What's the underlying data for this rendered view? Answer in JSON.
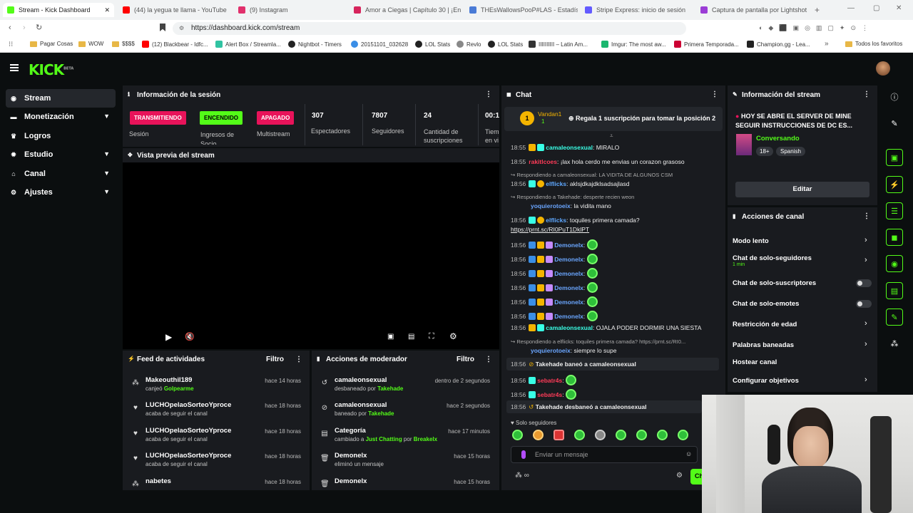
{
  "browser": {
    "tabs": [
      {
        "label": "Stream - Kick Dashboard",
        "color": "#53fc18"
      },
      {
        "label": "(44) la yegua te llama - YouTube",
        "color": "#ff0000"
      },
      {
        "label": "(9) Instagram",
        "color": "#e1306c"
      },
      {
        "label": "Amor a Ciegas | Capítulo 30 | ¡En bu",
        "color": "#d6245c"
      },
      {
        "label": "THEsWallowsPooP#LAS - Estadístic",
        "color": "#4a7bd6"
      },
      {
        "label": "Stripe Express: inicio de sesión",
        "color": "#635bff"
      },
      {
        "label": "Captura de pantalla por Lightshot",
        "color": "#9b3dd6"
      }
    ],
    "url": "https://dashboard.kick.com/stream",
    "bookmarks": [
      "Pagar Cosas",
      "WOW",
      "$$$$",
      "(12) Blackbear - Idfc...",
      "Alert Box / Streamla...",
      "Nightbot - Timers",
      "20151101_032628",
      "LOL Stats",
      "Revlo",
      "LOL Stats",
      "IIIIIIIIII – Latin Am...",
      "Imgur: The most aw...",
      "Primera Temporada...",
      "Champion.gg - Lea...",
      "Todos los favoritos"
    ]
  },
  "app": {
    "logo": "KICK",
    "logo_sup": "BETA"
  },
  "nav": [
    {
      "label": "Stream"
    },
    {
      "label": "Monetización"
    },
    {
      "label": "Logros"
    },
    {
      "label": "Estudio"
    },
    {
      "label": "Canal"
    },
    {
      "label": "Ajustes"
    }
  ],
  "session": {
    "title": "Información de la sesión",
    "badges": [
      {
        "text": "TRANSMITIENDO",
        "label": "Sesión",
        "bg": "#e8135a"
      },
      {
        "text": "ENCENDIDO",
        "label": "Ingresos de Socio",
        "bg": "#53fc18"
      },
      {
        "text": "APAGADO",
        "label": "Multistream",
        "bg": "#e8135a"
      }
    ],
    "metrics": [
      {
        "value": "307",
        "label": "Espectadores"
      },
      {
        "value": "7807",
        "label": "Seguidores"
      },
      {
        "value": "24",
        "label": "Cantidad de suscripciones"
      },
      {
        "value": "00:1",
        "label": "Tiem en vi"
      }
    ]
  },
  "preview": {
    "title": "Vista previa del stream"
  },
  "feed": {
    "title": "Feed de actividades",
    "filter": "Filtro",
    "items": [
      {
        "name": "Makeouthil189",
        "sub": "canjeó",
        "highlight": "Golpearme",
        "time": "hace 14 horas"
      },
      {
        "name": "LUCHOpelaoSorteoYproce",
        "sub": "acaba de seguir el canal",
        "highlight": "",
        "time": "hace 18 horas"
      },
      {
        "name": "LUCHOpelaoSorteoYproce",
        "sub": "acaba de seguir el canal",
        "highlight": "",
        "time": "hace 18 horas"
      },
      {
        "name": "LUCHOpelaoSorteoYproce",
        "sub": "acaba de seguir el canal",
        "highlight": "",
        "time": "hace 18 horas"
      },
      {
        "name": "nabetes",
        "sub": "",
        "highlight": "",
        "time": "hace 18 horas"
      }
    ]
  },
  "modactions": {
    "title": "Acciones de moderador",
    "filter": "Filtro",
    "items": [
      {
        "name": "camaleonsexual",
        "sub": "desbaneado por",
        "by": "Takehade",
        "time": "dentro de 2 segundos"
      },
      {
        "name": "camaleonsexual",
        "sub": "baneado por",
        "by": "Takehade",
        "time": "hace 2 segundos"
      },
      {
        "name": "Categoría",
        "sub": "cambiado a",
        "by": "Just Chatting",
        "by2": "Breakelx",
        "time": "hace 17 minutos"
      },
      {
        "name": "Demonelx",
        "sub": "eliminó un mensaje",
        "by": "",
        "time": "hace 15 horas"
      },
      {
        "name": "Demonelx",
        "sub": "",
        "by": "",
        "time": "hace 15 horas"
      }
    ]
  },
  "chat": {
    "title": "Chat",
    "pinned_user": "Vandan1",
    "pinned_count": "1",
    "pinned_text": "Regala 1 suscripción para tomar la posición 2",
    "lines": [
      {
        "time": "18:55",
        "user": "camaleonsexual",
        "text": ": MIRALO"
      },
      {
        "time": "18:55",
        "user": "rakitlcoes",
        "text": ": ¡lax hola cerdo me envias un corazon grasoso"
      },
      {
        "reply": "Respondiendo a camaleonsexual: LA VIDITA DE ALGUNOS CSM"
      },
      {
        "time": "18:56",
        "user": "elflicks",
        "text": ": aklsjdkajdklsadsajlasd"
      },
      {
        "reply": "Respondiendo a Takehade: desperte recien weon"
      },
      {
        "time": "",
        "user": "yoquierotoeix",
        "text": ": la vidita mano"
      },
      {
        "time": "18:56",
        "user": "elflicks",
        "text": ": toquiles primera camada?"
      },
      {
        "link": "https://prnt.sc/RI0PuT1DklPT"
      },
      {
        "time": "18:56",
        "user": "Demonelx",
        "text": ":"
      },
      {
        "time": "18:56",
        "user": "Demonelx",
        "text": ":"
      },
      {
        "time": "18:56",
        "user": "Demonelx",
        "text": ":"
      },
      {
        "time": "18:56",
        "user": "Demonelx",
        "text": ":"
      },
      {
        "time": "18:56",
        "user": "Demonelx",
        "text": ":"
      },
      {
        "time": "18:56",
        "user": "Demonelx",
        "text": ":"
      },
      {
        "time": "18:56",
        "user": "camaleonsexual",
        "text": ": OJALA PODER DORMIR UNA SIESTA"
      },
      {
        "reply": "Respondiendo a elflicks: toquiles primera camada? https://prnt.sc/RI0..."
      },
      {
        "time": "",
        "user": "yoquierotoeix",
        "text": ": siempre lo supe"
      },
      {
        "time": "18:56",
        "system": "Takehade baneó a camaleonsexual"
      },
      {
        "time": "18:56",
        "user": "sebatr4s",
        "text": ":"
      },
      {
        "time": "18:56",
        "user": "sebatr4s",
        "text": ":"
      },
      {
        "time": "18:56",
        "system": "Takehade desbaneó a camaleonsexual"
      }
    ],
    "followers_only": "Solo seguidores",
    "input_placeholder": "Enviar un mensaje",
    "send": "Ch"
  },
  "streaminfo": {
    "title": "Información del stream",
    "stream_title": "HOY SE ABRE EL SERVER DE MINE SEGUIR INSTRUCCIONES DE DC ES...",
    "category": "Conversando",
    "tags": [
      "18+",
      "Spanish"
    ],
    "edit": "Editar"
  },
  "channelactions": {
    "title": "Acciones de canal",
    "items": [
      {
        "label": "Modo lento",
        "sub": "",
        "kind": "arrow"
      },
      {
        "label": "Chat de solo-seguidores",
        "sub": "1 min",
        "kind": "arrow"
      },
      {
        "label": "Chat de solo-suscriptores",
        "sub": "",
        "kind": "toggle"
      },
      {
        "label": "Chat de solo-emotes",
        "sub": "",
        "kind": "toggle"
      },
      {
        "label": "Restricción de edad",
        "sub": "",
        "kind": "arrow"
      },
      {
        "label": "Palabras baneadas",
        "sub": "",
        "kind": "arrow"
      },
      {
        "label": "Hostear canal",
        "sub": "",
        "kind": "none"
      },
      {
        "label": "Configurar objetivos",
        "sub": "",
        "kind": "arrow"
      }
    ]
  },
  "colors": {
    "accent": "#53fc18",
    "live": "#e8135a",
    "panel": "#191b1f",
    "bg": "#0b0e0f"
  }
}
